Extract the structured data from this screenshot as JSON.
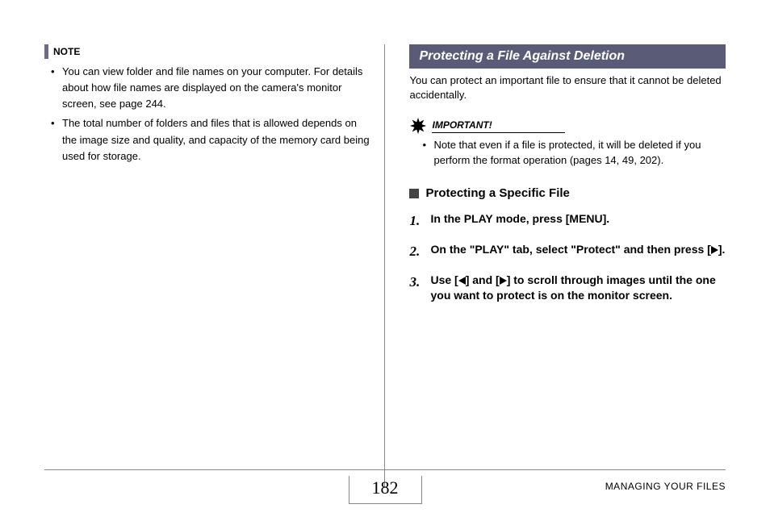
{
  "note": {
    "label": "NOTE",
    "bullets": [
      "You can view folder and file names on your computer. For details about how file names are displayed on the camera's monitor screen, see page 244.",
      "The total number of folders and files that is allowed depends on the image size and quality, and capacity of the memory card being used for storage."
    ]
  },
  "section": {
    "title": "Protecting a File Against Deletion",
    "intro": "You can protect an important file to ensure that it cannot be deleted accidentally."
  },
  "important": {
    "label": "IMPORTANT!",
    "bullets": [
      "Note that even if a file is protected, it will be deleted if you perform the format operation (pages 14, 49, 202)."
    ]
  },
  "subsection": {
    "title": "Protecting a Specific File"
  },
  "steps": [
    {
      "num": "1.",
      "pre": "In the PLAY mode, press [MENU]."
    },
    {
      "num": "2.",
      "pre": "On the \"PLAY\" tab, select \"Protect\" and then press [",
      "icon1": "right",
      "post": "]."
    },
    {
      "num": "3.",
      "pre": "Use [",
      "icon1": "left",
      "mid": "] and [",
      "icon2": "right",
      "post": "] to scroll through images until the one you want to protect is on the monitor screen."
    }
  ],
  "footer": {
    "page": "182",
    "section": "MANAGING YOUR FILES"
  }
}
